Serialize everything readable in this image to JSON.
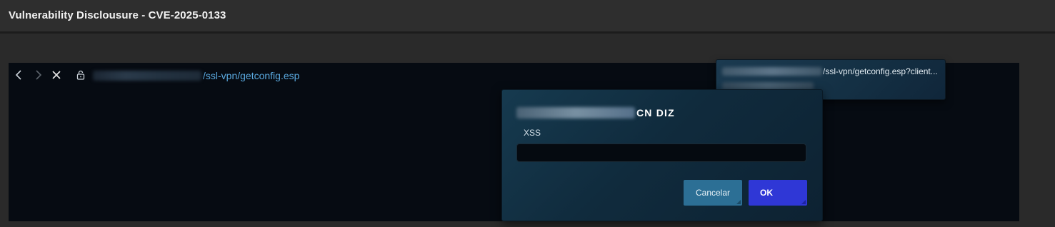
{
  "window": {
    "title": "Vulnerability Disclousure - CVE-2025-0133"
  },
  "browser": {
    "url_visible": "/ssl-vpn/getconfig.esp",
    "icons": [
      "back-arrow-icon",
      "forward-arrow-icon",
      "close-icon",
      "lock-icon"
    ]
  },
  "suggestion": {
    "url_visible": "/ssl-vpn/getconfig.esp?client..."
  },
  "dialog": {
    "heading_suffix": "CN DIZ",
    "message": "XSS",
    "input_value": "",
    "cancel_label": "Cancelar",
    "ok_label": "OK"
  },
  "colors": {
    "link": "#5aa9df",
    "ok_button": "#2f37d6",
    "cancel_button": "#2c6f95"
  }
}
